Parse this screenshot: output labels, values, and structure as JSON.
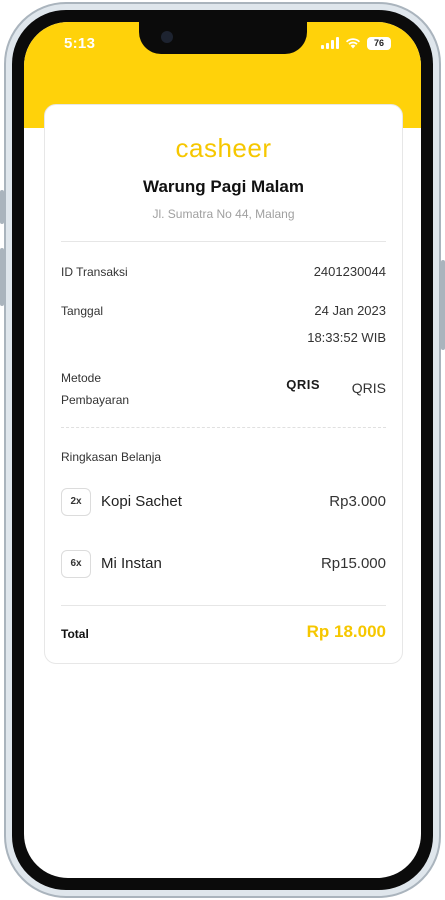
{
  "status_bar": {
    "time": "5:13",
    "battery": "76"
  },
  "receipt": {
    "brand": "casheer",
    "store_name": "Warung Pagi Malam",
    "store_address": "Jl. Sumatra No 44, Malang",
    "transaction_id_label": "ID Transaksi",
    "transaction_id": "2401230044",
    "date_label": "Tanggal",
    "date": "24 Jan 2023",
    "time": "18:33:52 WIB",
    "payment_label_line1": "Metode",
    "payment_label_line2": "Pembayaran",
    "payment_logo": "QRIS",
    "payment_method": "QRIS",
    "summary_label": "Ringkasan Belanja",
    "items": [
      {
        "qty": "2x",
        "name": "Kopi Sachet",
        "price": "Rp3.000"
      },
      {
        "qty": "6x",
        "name": "Mi Instan",
        "price": "Rp15.000"
      }
    ],
    "total_label": "Total",
    "total_value": "Rp 18.000"
  },
  "colors": {
    "accent": "#ffd20a",
    "brand_text": "#f6c700"
  },
  "icons": [
    "front-camera-icon",
    "signal-icon",
    "wifi-icon",
    "battery-icon",
    "qris-logo-icon"
  ]
}
